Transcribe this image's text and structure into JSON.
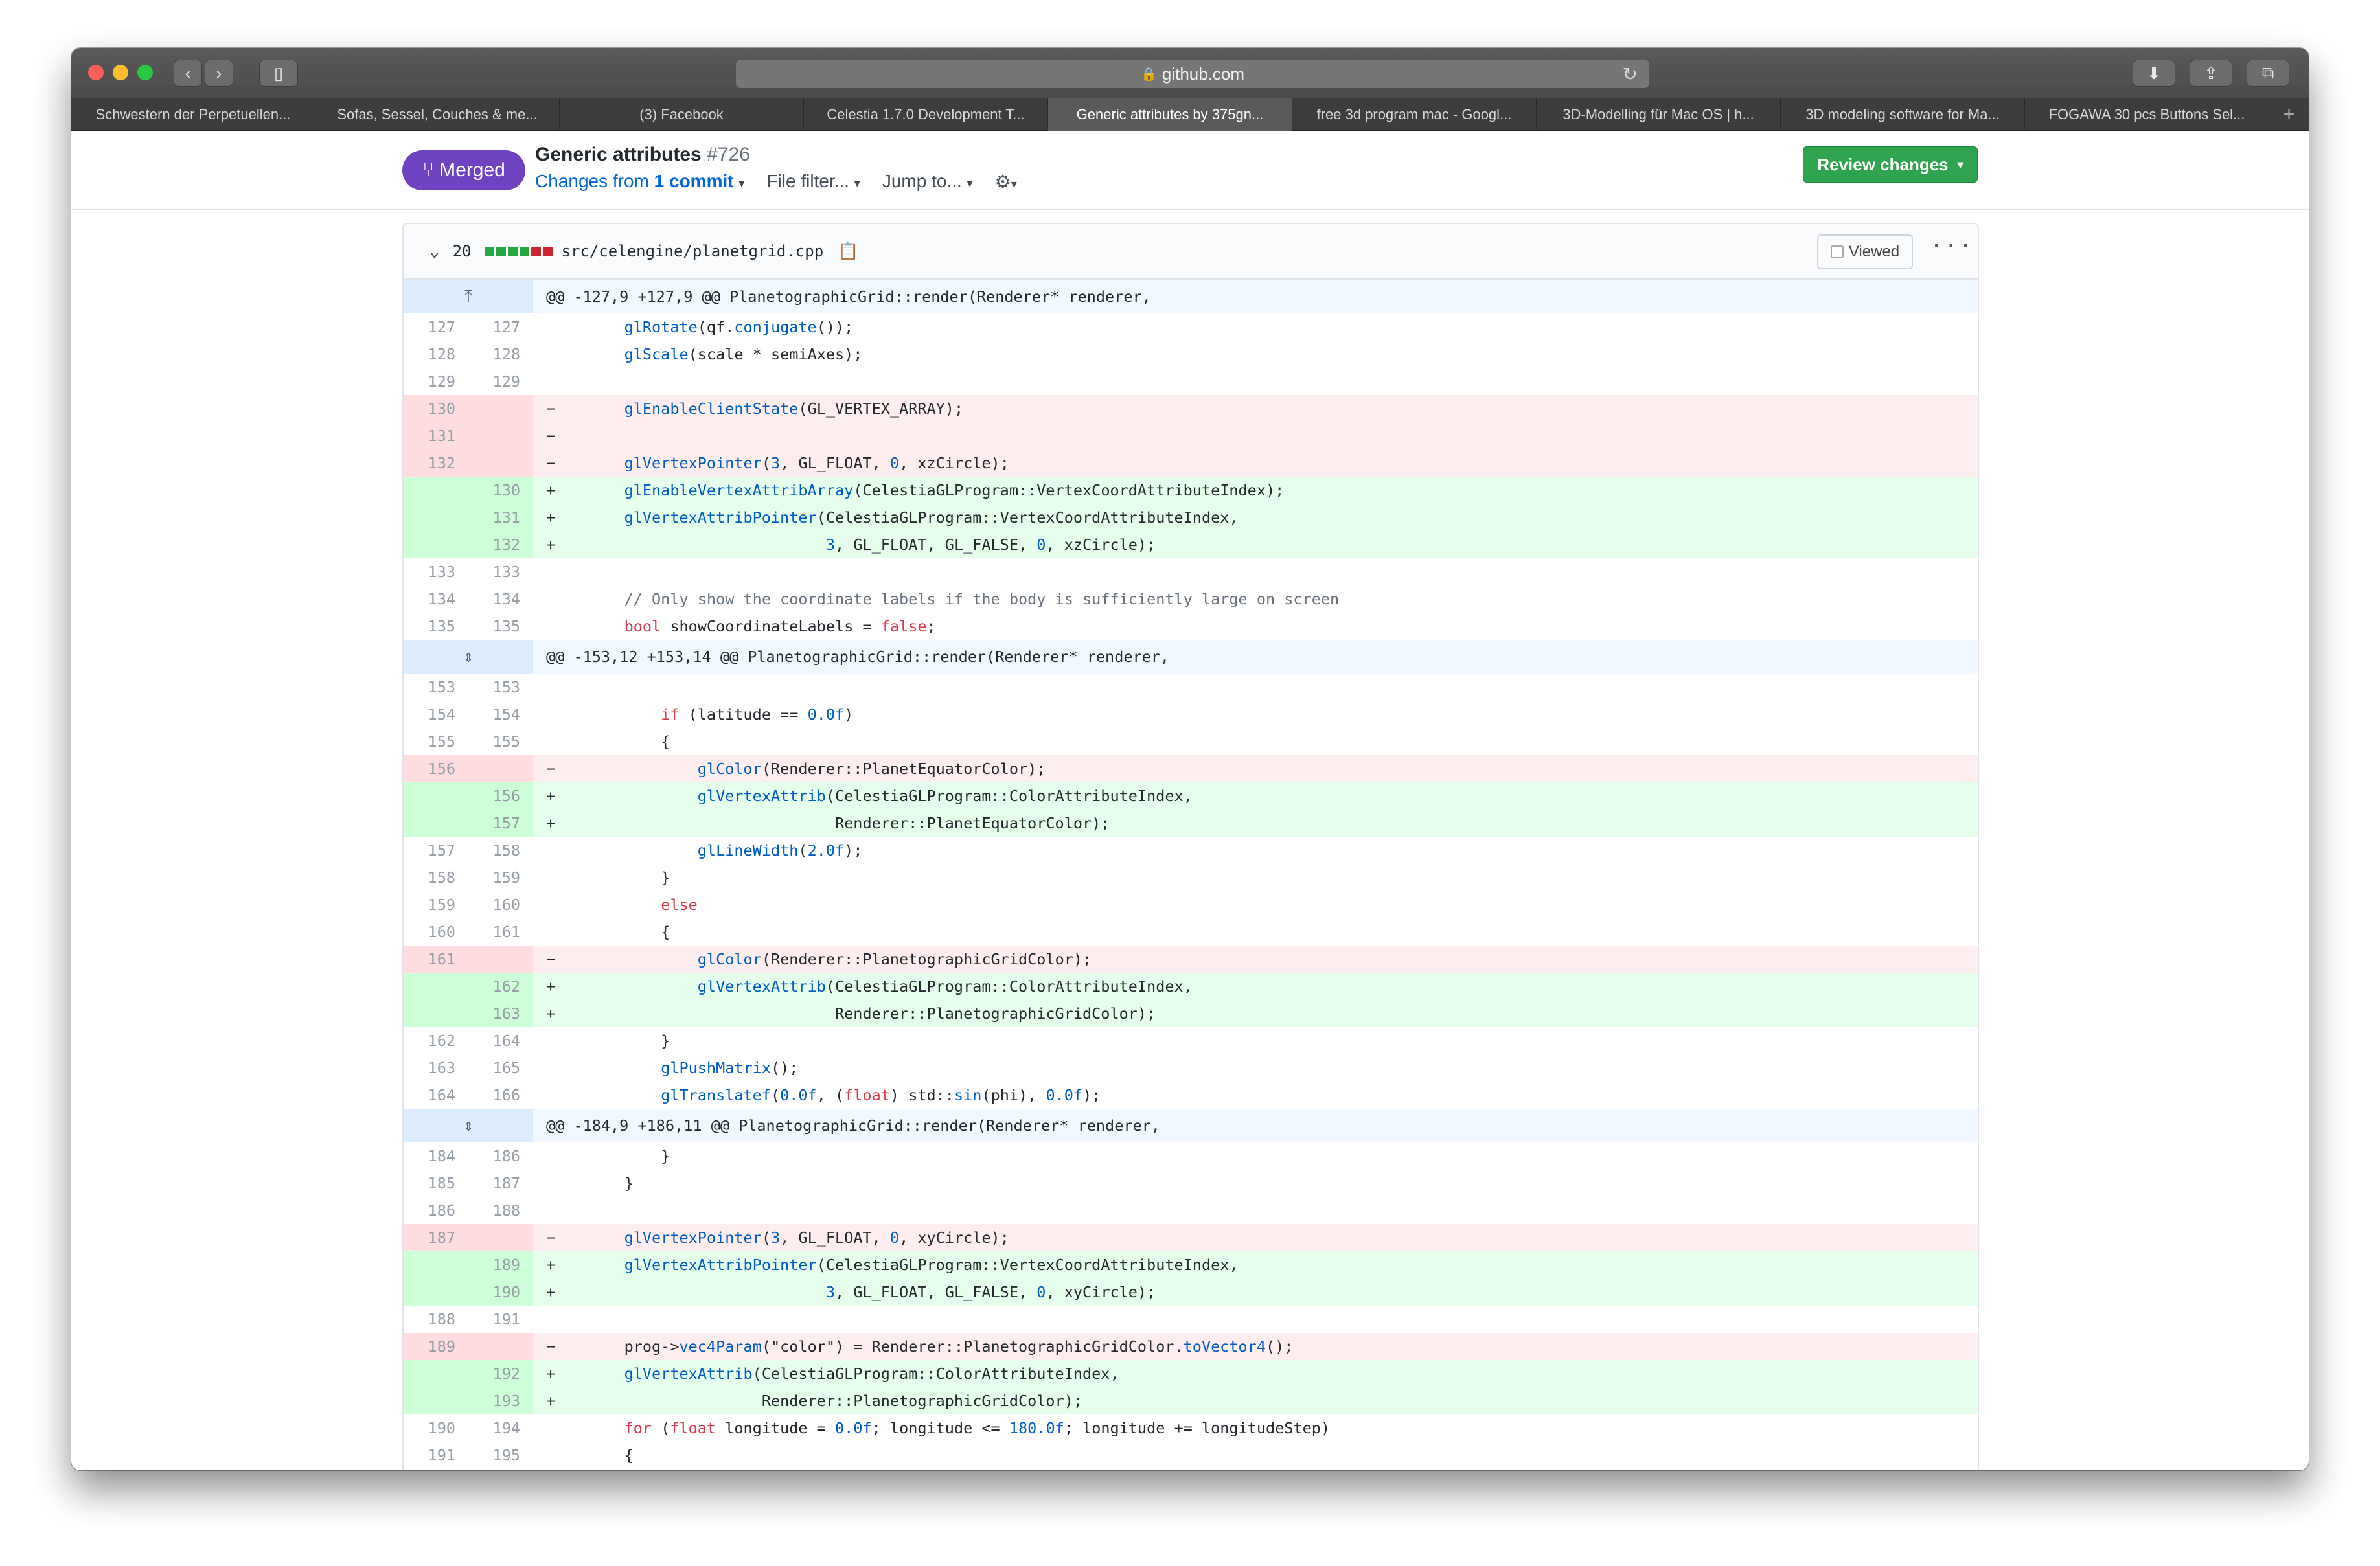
{
  "browser": {
    "address": "github.com",
    "tabs": [
      {
        "label": "Schwestern der Perpetuellen..."
      },
      {
        "label": "Sofas, Sessel, Couches & me..."
      },
      {
        "label": "(3) Facebook"
      },
      {
        "label": "Celestia 1.7.0 Development T..."
      },
      {
        "label": "Generic attributes by 375gn...",
        "active": true
      },
      {
        "label": "free 3d program mac - Googl..."
      },
      {
        "label": "3D-Modelling für Mac OS | h..."
      },
      {
        "label": "3D modeling software for Ma..."
      },
      {
        "label": "FOGAWA 30 pcs Buttons Sel..."
      }
    ],
    "new_tab": "+"
  },
  "pr": {
    "status": "Merged",
    "title": "Generic attributes",
    "number": "#726",
    "changes_prefix": "Changes from",
    "changes_link": "1 commit",
    "file_filter": "File filter...",
    "jump_to": "Jump to...",
    "review_button": "Review changes"
  },
  "file": {
    "changes": "20",
    "path": "src/celengine/planetgrid.cpp",
    "viewed_label": "Viewed",
    "more": "···",
    "stat_colors": [
      "#28a745",
      "#28a745",
      "#28a745",
      "#28a745",
      "#cb2431",
      "#cb2431"
    ]
  },
  "diff": [
    {
      "t": "hunk",
      "code": "@@ -127,9 +127,9 @@ PlanetographicGrid::render(Renderer* renderer,"
    },
    {
      "t": "ctx",
      "a": "127",
      "b": "127",
      "code": "    glRotate(qf.conjugate());"
    },
    {
      "t": "ctx",
      "a": "128",
      "b": "128",
      "code": "    glScale(scale * semiAxes);"
    },
    {
      "t": "ctx",
      "a": "129",
      "b": "129",
      "code": ""
    },
    {
      "t": "del",
      "a": "130",
      "b": "",
      "code": "    glEnableClientState(GL_VERTEX_ARRAY);"
    },
    {
      "t": "del",
      "a": "131",
      "b": "",
      "code": ""
    },
    {
      "t": "del",
      "a": "132",
      "b": "",
      "code": "    glVertexPointer(3, GL_FLOAT, 0, xzCircle);"
    },
    {
      "t": "add",
      "a": "",
      "b": "130",
      "code": "    glEnableVertexAttribArray(CelestiaGLProgram::VertexCoordAttributeIndex);"
    },
    {
      "t": "add",
      "a": "",
      "b": "131",
      "code": "    glVertexAttribPointer(CelestiaGLProgram::VertexCoordAttributeIndex,"
    },
    {
      "t": "add",
      "a": "",
      "b": "132",
      "code": "                          3, GL_FLOAT, GL_FALSE, 0, xzCircle);"
    },
    {
      "t": "ctx",
      "a": "133",
      "b": "133",
      "code": ""
    },
    {
      "t": "ctx",
      "a": "134",
      "b": "134",
      "code": "    // Only show the coordinate labels if the body is sufficiently large on screen"
    },
    {
      "t": "ctx",
      "a": "135",
      "b": "135",
      "code": "    bool showCoordinateLabels = false;"
    },
    {
      "t": "hunk",
      "code": "@@ -153,12 +153,14 @@ PlanetographicGrid::render(Renderer* renderer,"
    },
    {
      "t": "ctx",
      "a": "153",
      "b": "153",
      "code": ""
    },
    {
      "t": "ctx",
      "a": "154",
      "b": "154",
      "code": "        if (latitude == 0.0f)"
    },
    {
      "t": "ctx",
      "a": "155",
      "b": "155",
      "code": "        {"
    },
    {
      "t": "del",
      "a": "156",
      "b": "",
      "code": "            glColor(Renderer::PlanetEquatorColor);"
    },
    {
      "t": "add",
      "a": "",
      "b": "156",
      "code": "            glVertexAttrib(CelestiaGLProgram::ColorAttributeIndex,"
    },
    {
      "t": "add",
      "a": "",
      "b": "157",
      "code": "                           Renderer::PlanetEquatorColor);"
    },
    {
      "t": "ctx",
      "a": "157",
      "b": "158",
      "code": "            glLineWidth(2.0f);"
    },
    {
      "t": "ctx",
      "a": "158",
      "b": "159",
      "code": "        }"
    },
    {
      "t": "ctx",
      "a": "159",
      "b": "160",
      "code": "        else"
    },
    {
      "t": "ctx",
      "a": "160",
      "b": "161",
      "code": "        {"
    },
    {
      "t": "del",
      "a": "161",
      "b": "",
      "code": "            glColor(Renderer::PlanetographicGridColor);"
    },
    {
      "t": "add",
      "a": "",
      "b": "162",
      "code": "            glVertexAttrib(CelestiaGLProgram::ColorAttributeIndex,"
    },
    {
      "t": "add",
      "a": "",
      "b": "163",
      "code": "                           Renderer::PlanetographicGridColor);"
    },
    {
      "t": "ctx",
      "a": "162",
      "b": "164",
      "code": "        }"
    },
    {
      "t": "ctx",
      "a": "163",
      "b": "165",
      "code": "        glPushMatrix();"
    },
    {
      "t": "ctx",
      "a": "164",
      "b": "166",
      "code": "        glTranslatef(0.0f, (float) std::sin(phi), 0.0f);"
    },
    {
      "t": "hunk",
      "code": "@@ -184,9 +186,11 @@ PlanetographicGrid::render(Renderer* renderer,"
    },
    {
      "t": "ctx",
      "a": "184",
      "b": "186",
      "code": "        }"
    },
    {
      "t": "ctx",
      "a": "185",
      "b": "187",
      "code": "    }"
    },
    {
      "t": "ctx",
      "a": "186",
      "b": "188",
      "code": ""
    },
    {
      "t": "del",
      "a": "187",
      "b": "",
      "code": "    glVertexPointer(3, GL_FLOAT, 0, xyCircle);"
    },
    {
      "t": "add",
      "a": "",
      "b": "189",
      "code": "    glVertexAttribPointer(CelestiaGLProgram::VertexCoordAttributeIndex,"
    },
    {
      "t": "add",
      "a": "",
      "b": "190",
      "code": "                          3, GL_FLOAT, GL_FALSE, 0, xyCircle);"
    },
    {
      "t": "ctx",
      "a": "188",
      "b": "191",
      "code": ""
    },
    {
      "t": "del",
      "a": "189",
      "b": "",
      "code": "    prog->vec4Param(\"color\") = Renderer::PlanetographicGridColor.toVector4();"
    },
    {
      "t": "add",
      "a": "",
      "b": "192",
      "code": "    glVertexAttrib(CelestiaGLProgram::ColorAttributeIndex,"
    },
    {
      "t": "add",
      "a": "",
      "b": "193",
      "code": "                   Renderer::PlanetographicGridColor);"
    },
    {
      "t": "ctx",
      "a": "190",
      "b": "194",
      "code": "    for (float longitude = 0.0f; longitude <= 180.0f; longitude += longitudeStep)"
    },
    {
      "t": "ctx",
      "a": "191",
      "b": "195",
      "code": "    {"
    }
  ]
}
